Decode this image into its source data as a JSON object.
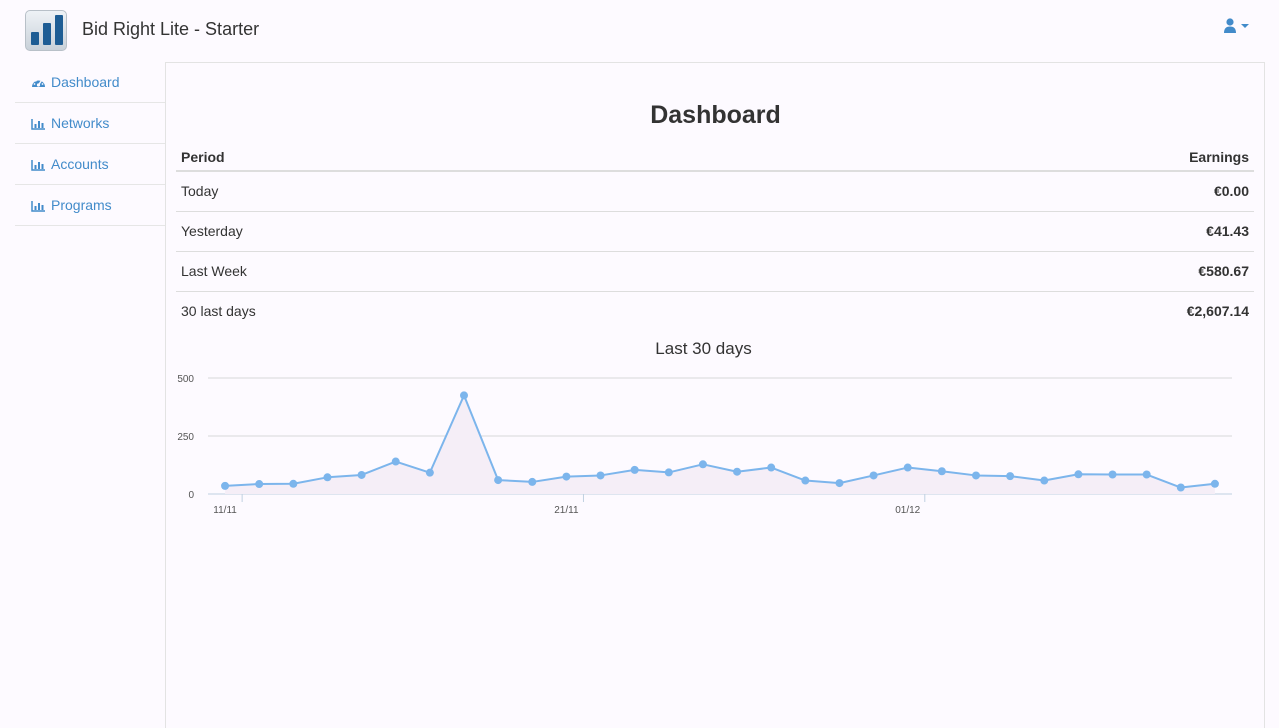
{
  "app": {
    "title": "Bid Right Lite - Starter"
  },
  "header": {
    "user_menu_icon": "user-icon",
    "accent": "#428bca"
  },
  "sidebar": {
    "items": [
      {
        "label": "Dashboard",
        "icon": "tachometer-icon"
      },
      {
        "label": "Networks",
        "icon": "bar-chart-icon"
      },
      {
        "label": "Accounts",
        "icon": "bar-chart-icon"
      },
      {
        "label": "Programs",
        "icon": "bar-chart-icon"
      }
    ]
  },
  "main": {
    "title": "Dashboard",
    "table": {
      "headers": {
        "period": "Period",
        "earnings": "Earnings"
      },
      "rows": [
        {
          "period": "Today",
          "earnings": "€0.00"
        },
        {
          "period": "Yesterday",
          "earnings": "€41.43"
        },
        {
          "period": "Last Week",
          "earnings": "€580.67"
        },
        {
          "period": "30 last days",
          "earnings": "€2,607.14"
        }
      ]
    }
  },
  "chart_data": {
    "type": "line",
    "title": "Last 30 days",
    "xlabel": "",
    "ylabel": "",
    "ylim": [
      0,
      500
    ],
    "yticks": [
      0,
      250,
      500
    ],
    "x": [
      "11/11",
      "12/11",
      "13/11",
      "14/11",
      "15/11",
      "16/11",
      "17/11",
      "18/11",
      "19/11",
      "20/11",
      "21/11",
      "22/11",
      "23/11",
      "24/11",
      "25/11",
      "26/11",
      "27/11",
      "28/11",
      "29/11",
      "30/11",
      "01/12",
      "02/12",
      "03/12",
      "04/12",
      "05/12",
      "06/12",
      "07/12",
      "08/12",
      "09/12",
      "10/12"
    ],
    "xtick_labels": [
      "11/11",
      "21/11",
      "01/12"
    ],
    "series": [
      {
        "values": [
          35,
          43,
          44,
          72,
          82,
          140,
          92,
          425,
          60,
          52,
          75,
          80,
          104,
          93,
          128,
          96,
          114,
          58,
          47,
          80,
          114,
          98,
          80,
          77,
          58,
          85,
          84,
          84,
          28,
          44
        ],
        "color": "#7cb5ec"
      }
    ],
    "grid": true,
    "legend": "none"
  }
}
